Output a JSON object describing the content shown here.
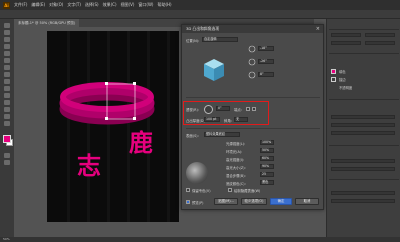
{
  "app": {
    "logo": "Ai"
  },
  "menu": [
    "文件(F)",
    "编辑(E)",
    "对象(O)",
    "文字(T)",
    "选择(S)",
    "效果(C)",
    "视图(V)",
    "窗口(W)",
    "帮助(H)"
  ],
  "document_tab": {
    "label": "未标题-1* @ 50% (RGB/GPU 预览)"
  },
  "artwork": {
    "char_1": "鹿",
    "char_2": "志",
    "color": "#e6007e"
  },
  "dialog": {
    "title": "3D 凸出和斜角选项",
    "close": "×",
    "position_label": "位置(N):",
    "position_value": "自定旋转",
    "rot_x": "-18°",
    "rot_y": "-26°",
    "rot_z": "8°",
    "perspective_label": "透视(R):",
    "perspective_value": "0°",
    "extrude_depth_label": "凸出厚度(D):",
    "extrude_depth_value": "100 pt",
    "cap_label": "端点:",
    "bevel_label": "斜角:",
    "bevel_value": "无",
    "height_label": "高度(H):",
    "height_value": "4 pt",
    "surface_label": "表面(S):",
    "surface_value": "塑料效果底纹",
    "light_intensity_label": "光源强度(L):",
    "light_intensity_value": "100%",
    "ambient_label": "环境光(A):",
    "ambient_value": "50%",
    "highlight_label": "高光强度(I):",
    "highlight_value": "60%",
    "highlight_size_label": "高光大小(Z):",
    "highlight_size_value": "90%",
    "blend_steps_label": "混合步骤(B):",
    "blend_steps_value": "25",
    "shading_color_label": "底纹颜色(C):",
    "shading_color_value": "黑色",
    "preserve_spot_label": "保留专色(V)",
    "draw_hidden_label": "绘制隐藏表面(W)",
    "preview_label": "预览(P)",
    "map_art_button": "贴图(M)...",
    "fewer_options_button": "较少选项(O)",
    "ok_button": "确定",
    "cancel_button": "取消"
  },
  "panel": {
    "fill_label": "填色",
    "stroke_label": "描边",
    "opacity_label": "不透明度"
  },
  "status": {
    "zoom": "50%"
  },
  "colors": {
    "accent": "#e6007e",
    "highlight_box": "#e11b1b",
    "cube_top": "#8fd0e8",
    "cube_front": "#5fb3d6"
  }
}
